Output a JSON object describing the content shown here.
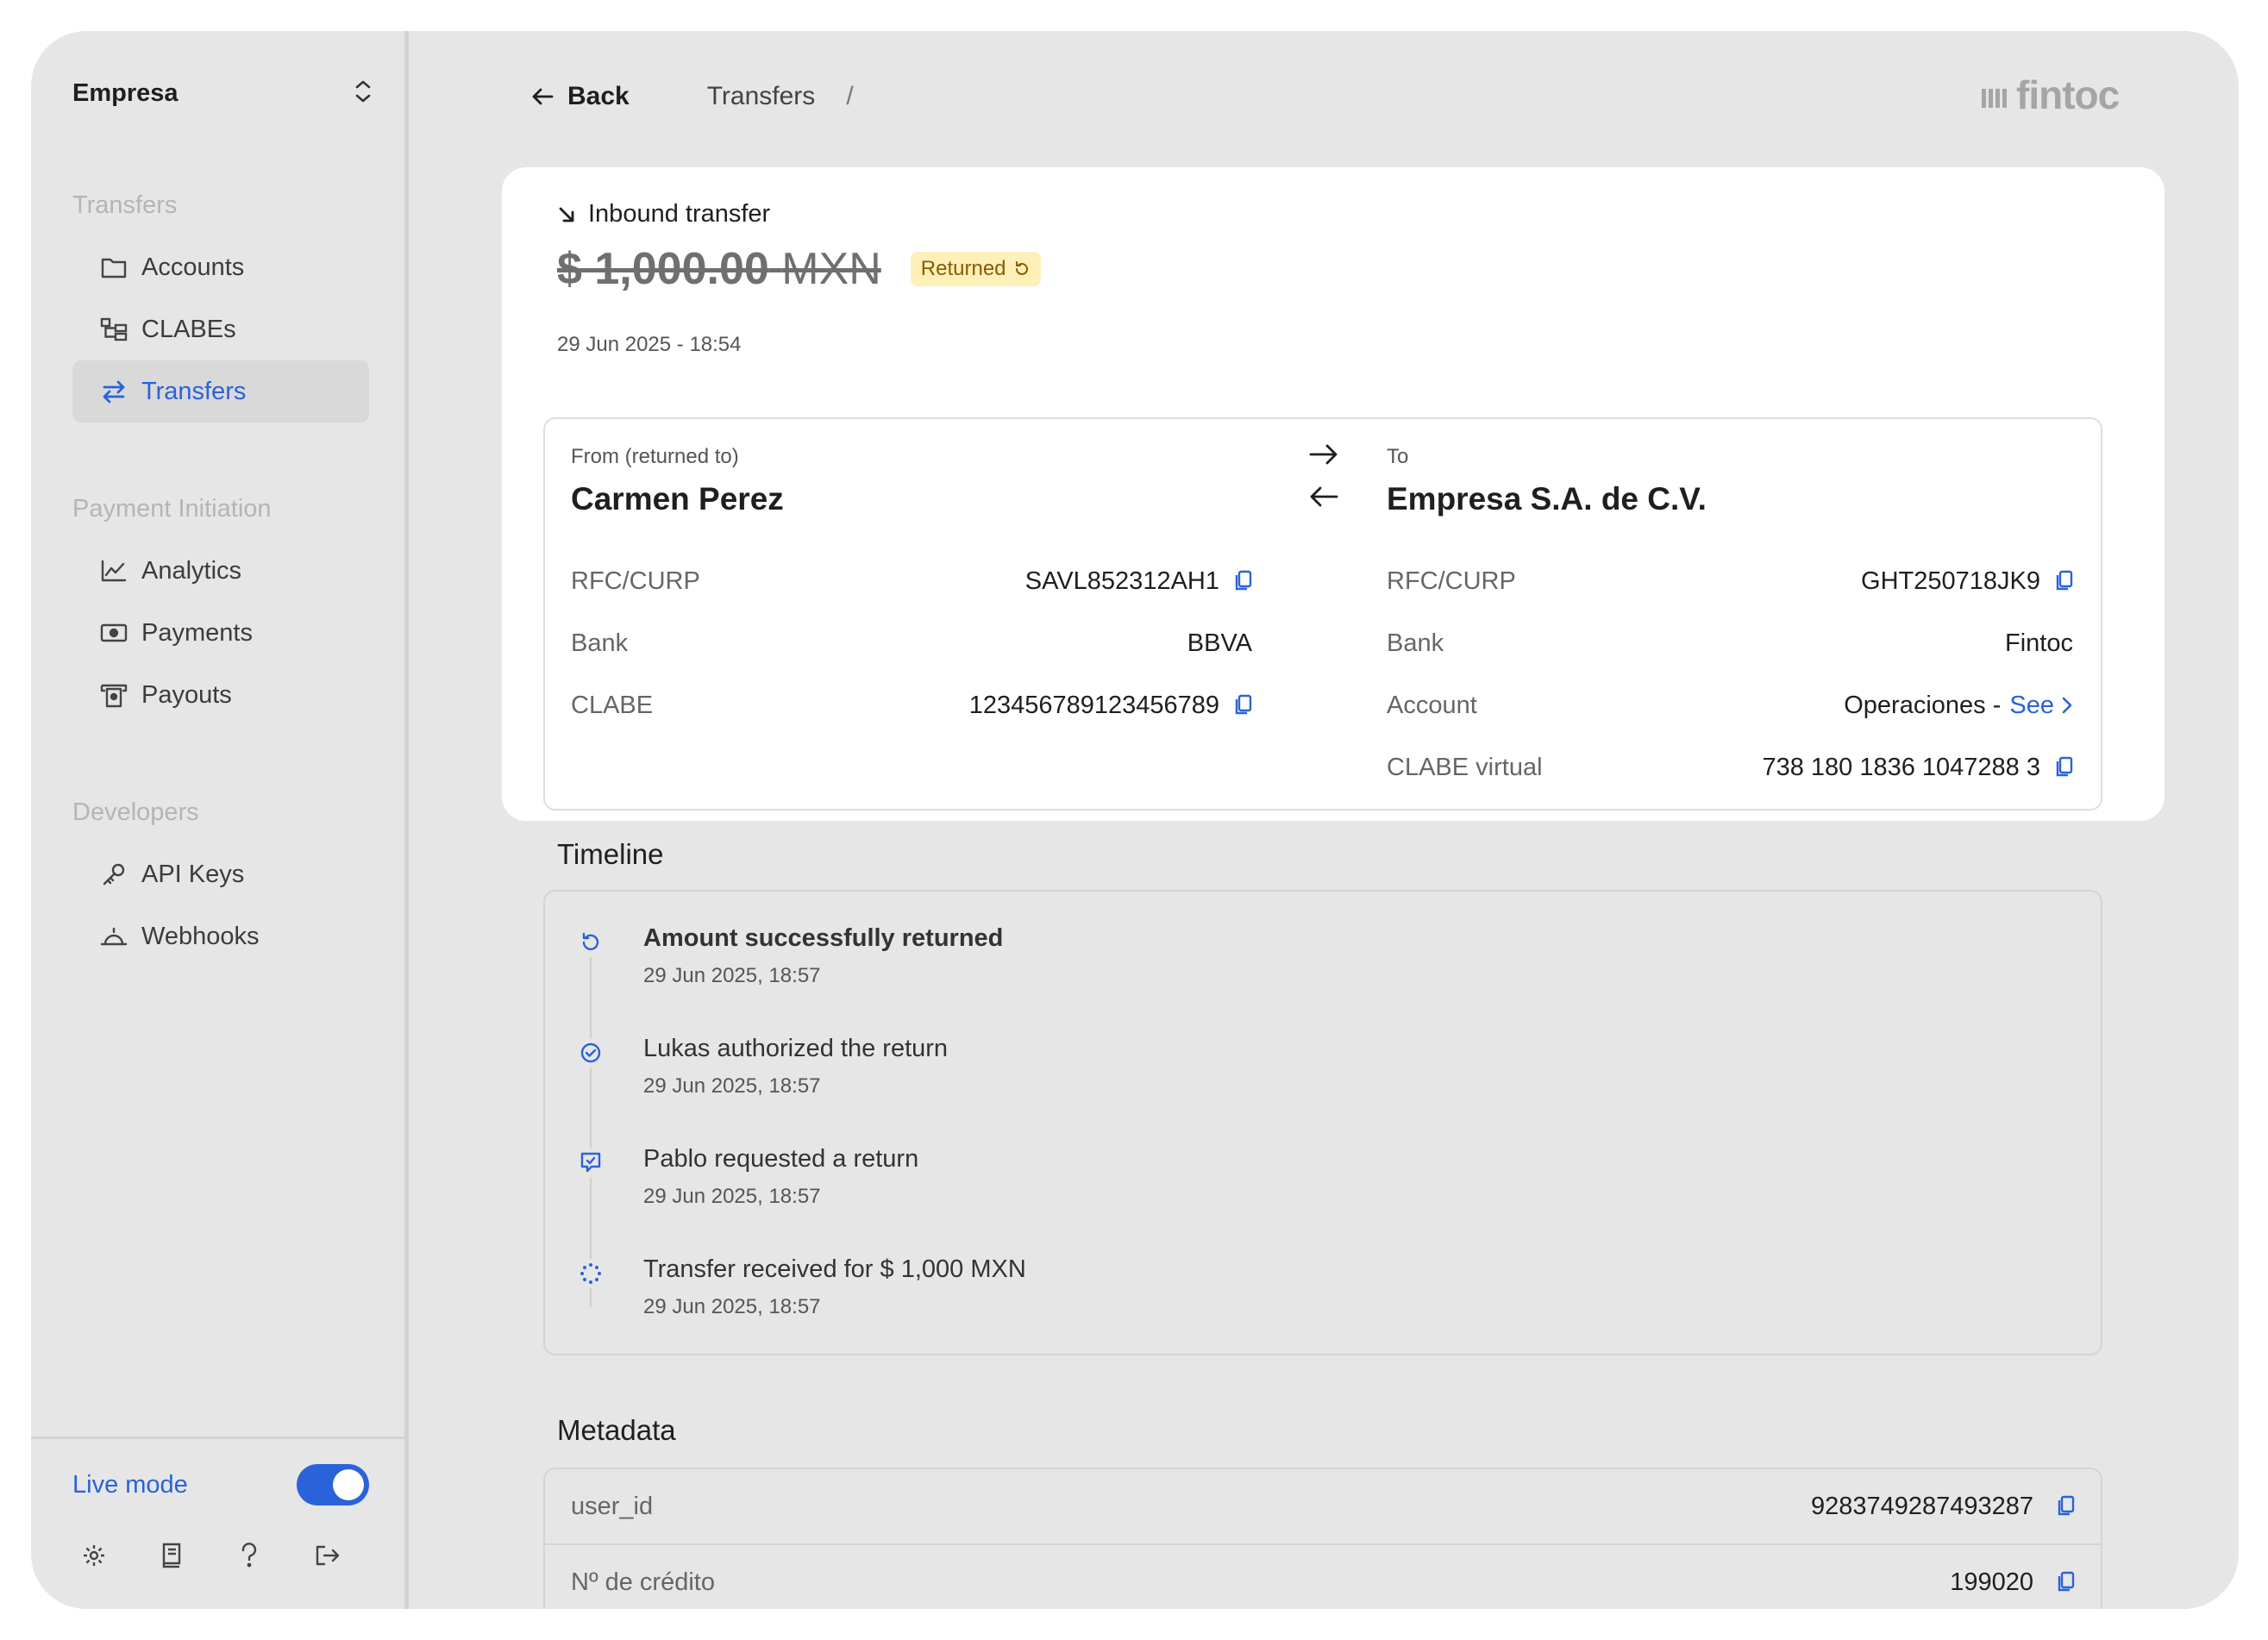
{
  "sidebar": {
    "org_name": "Empresa",
    "sections": [
      {
        "title": "Transfers"
      },
      {
        "title": "Payment Initiation"
      },
      {
        "title": "Developers"
      }
    ],
    "items": [
      {
        "label": "Accounts",
        "icon": "folder-icon"
      },
      {
        "label": "CLABEs",
        "icon": "tree-icon"
      },
      {
        "label": "Transfers",
        "icon": "swap-icon",
        "active": true
      },
      {
        "label": "Analytics",
        "icon": "chart-line-icon"
      },
      {
        "label": "Payments",
        "icon": "banknote-icon"
      },
      {
        "label": "Payouts",
        "icon": "payout-icon"
      },
      {
        "label": "API Keys",
        "icon": "key-icon"
      },
      {
        "label": "Webhooks",
        "icon": "bell-icon"
      }
    ],
    "live_mode_label": "Live mode",
    "live_mode_on": true,
    "footer_icons": [
      "gear-icon",
      "book-icon",
      "help-icon",
      "logout-icon"
    ]
  },
  "topbar": {
    "back_label": "Back",
    "breadcrumb": "Transfers",
    "separator": "/",
    "logo_text": "fintoc"
  },
  "transfer": {
    "type_label": "Inbound transfer",
    "amount": "$ 1,000.00",
    "currency": "MXN",
    "status": "Returned",
    "date": "29 Jun 2025 - 18:54",
    "from": {
      "label": "From (returned to)",
      "name": "Carmen Perez",
      "fields": [
        {
          "key": "RFC/CURP",
          "value": "SAVL852312AH1"
        },
        {
          "key": "Bank",
          "value": "BBVA"
        },
        {
          "key": "CLABE",
          "value": "123456789123456789"
        }
      ]
    },
    "to": {
      "label": "To",
      "name": "Empresa S.A. de C.V.",
      "fields": [
        {
          "key": "RFC/CURP",
          "value": "GHT250718JK9"
        },
        {
          "key": "Bank",
          "value": "Fintoc"
        },
        {
          "key": "Account",
          "value": "Operaciones -",
          "link": "See"
        },
        {
          "key": "CLABE virtual",
          "value": "738 180 1836 1047288 3"
        }
      ]
    }
  },
  "timeline": {
    "title": "Timeline",
    "events": [
      {
        "title": "Amount successfully returned",
        "date": "29 Jun 2025, 18:57"
      },
      {
        "title": "Lukas authorized the return",
        "date": "29 Jun 2025, 18:57"
      },
      {
        "title": "Pablo requested a return",
        "date": "29 Jun 2025, 18:57"
      },
      {
        "title": "Transfer received for $ 1,000 MXN",
        "date": "29 Jun 2025, 18:57"
      }
    ]
  },
  "metadata": {
    "title": "Metadata",
    "rows": [
      {
        "key": "user_id",
        "value": "9283749287493287"
      },
      {
        "key": "Nº de crédito",
        "value": "199020"
      }
    ]
  },
  "colors": {
    "accent": "#2a62d9",
    "background": "#e6e6e6",
    "badge_bg": "#fdf0b8",
    "badge_text": "#8a5a00"
  }
}
